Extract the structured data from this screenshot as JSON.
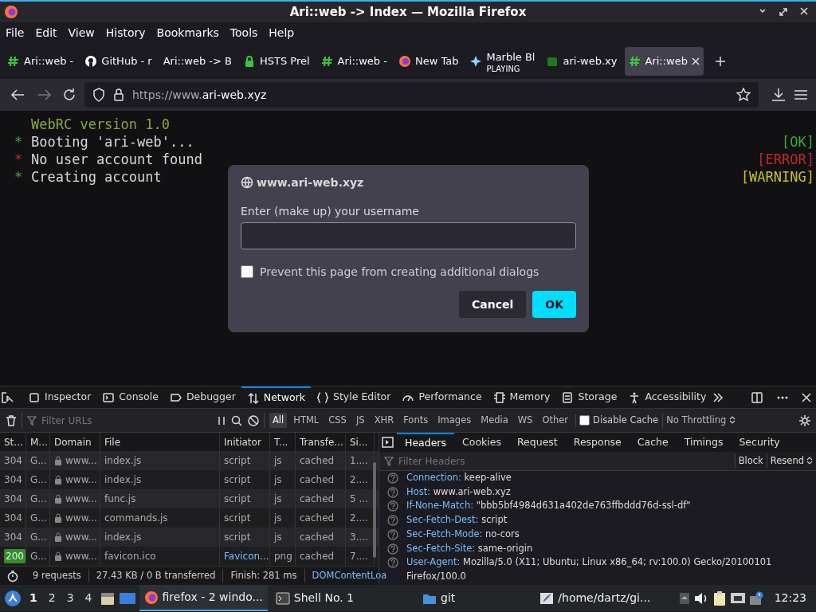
{
  "window": {
    "title": "Ari::web -> Index — Mozilla Firefox"
  },
  "menu": [
    "File",
    "Edit",
    "View",
    "History",
    "Bookmarks",
    "Tools",
    "Help"
  ],
  "tabs": [
    {
      "label": "Ari::web -",
      "kind": "hash",
      "selected": false
    },
    {
      "label": "GitHub - r",
      "kind": "github",
      "selected": false
    },
    {
      "label": "Ari::web -> B",
      "kind": "plain",
      "selected": false
    },
    {
      "label": "HSTS Prel",
      "kind": "lock",
      "selected": false
    },
    {
      "label": "Ari::web -",
      "kind": "hash",
      "selected": false
    },
    {
      "label": "New Tab",
      "kind": "firefox",
      "selected": false
    },
    {
      "label": "Marble Bl",
      "sub": "PLAYING",
      "kind": "marble",
      "selected": false
    },
    {
      "label": "ari-web.xy",
      "kind": "square",
      "selected": false
    },
    {
      "label": "Ari::web",
      "kind": "hash",
      "selected": true
    }
  ],
  "address": {
    "prefix": "https://www.",
    "host": "ari-web.xyz"
  },
  "terminal": [
    {
      "text": "WebRC version 1.0",
      "kind": "heading"
    },
    {
      "bullet": "*",
      "text": "Booting 'ari-web'...",
      "status": "[OK]",
      "kind": "ok"
    },
    {
      "bullet": "*",
      "text": "No user account found",
      "status": "[ERROR]",
      "kind": "error"
    },
    {
      "bullet": "*",
      "text": "Creating account",
      "status": "[WARNING]",
      "kind": "warning"
    }
  ],
  "dialog": {
    "host": "www.ari-web.xyz",
    "prompt": "Enter (make up) your username",
    "checkbox": {
      "label": "Prevent this page from creating additional dialogs",
      "checked": false
    },
    "buttons": [
      {
        "label": "Cancel",
        "kind": "secondary"
      },
      {
        "label": "OK",
        "kind": "primary"
      }
    ]
  },
  "devtools": {
    "tabs": [
      {
        "label": "Inspector",
        "selected": false
      },
      {
        "label": "Console",
        "selected": false
      },
      {
        "label": "Debugger",
        "selected": false
      },
      {
        "label": "Network",
        "selected": true
      },
      {
        "label": "Style Editor",
        "selected": false
      },
      {
        "label": "Performance",
        "selected": false
      },
      {
        "label": "Memory",
        "selected": false
      },
      {
        "label": "Storage",
        "selected": false
      },
      {
        "label": "Accessibility",
        "selected": false
      }
    ],
    "filter": {
      "placeholder": "Filter URLs"
    },
    "types": [
      {
        "label": "All",
        "selected": true
      },
      {
        "label": "HTML",
        "selected": false
      },
      {
        "label": "CSS",
        "selected": false
      },
      {
        "label": "JS",
        "selected": false
      },
      {
        "label": "XHR",
        "selected": false
      },
      {
        "label": "Fonts",
        "selected": false
      },
      {
        "label": "Images",
        "selected": false
      },
      {
        "label": "Media",
        "selected": false
      },
      {
        "label": "WS",
        "selected": false
      },
      {
        "label": "Other",
        "selected": false
      }
    ],
    "disable_cache": {
      "label": "Disable Cache",
      "checked": false
    },
    "throttling": "No Throttling",
    "table": {
      "columns": [
        "St...",
        "M...",
        "Domain",
        "File",
        "Initiator",
        "T...",
        "Transfe...",
        "Si..."
      ],
      "rows": [
        {
          "cells": [
            "304",
            "G...",
            "www...",
            "index.js",
            "script",
            "js",
            "cached",
            "1...."
          ],
          "success": false,
          "initiator_link": false
        },
        {
          "cells": [
            "304",
            "G...",
            "www...",
            "index.js",
            "script",
            "js",
            "cached",
            "2...."
          ],
          "success": false,
          "initiator_link": false
        },
        {
          "cells": [
            "304",
            "G...",
            "www...",
            "func.js",
            "script",
            "js",
            "cached",
            "5 ..."
          ],
          "success": false,
          "initiator_link": false
        },
        {
          "cells": [
            "304",
            "G...",
            "www...",
            "commands.js",
            "script",
            "js",
            "cached",
            "2...."
          ],
          "success": false,
          "initiator_link": false
        },
        {
          "cells": [
            "304",
            "G...",
            "www...",
            "index.js",
            "script",
            "js",
            "cached",
            "3...."
          ],
          "success": false,
          "initiator_link": false
        },
        {
          "cells": [
            "200",
            "G...",
            "www...",
            "favicon.ico",
            "Favicon...",
            "png",
            "cached",
            "7...."
          ],
          "success": true,
          "initiator_link": true
        }
      ]
    },
    "summary": [
      "9 requests",
      "27.43 KB / 0 B transferred",
      "Finish: 281 ms",
      "DOMContentLoa"
    ],
    "detail_tabs": [
      {
        "label": "Headers",
        "selected": true
      },
      {
        "label": "Cookies",
        "selected": false
      },
      {
        "label": "Request",
        "selected": false
      },
      {
        "label": "Response",
        "selected": false
      },
      {
        "label": "Cache",
        "selected": false
      },
      {
        "label": "Timings",
        "selected": false
      },
      {
        "label": "Security",
        "selected": false
      }
    ],
    "header_filter": {
      "placeholder": "Filter Headers"
    },
    "header_actions": [
      "Block",
      "Resend"
    ],
    "headers": [
      {
        "name": "Connection:",
        "value": "keep-alive"
      },
      {
        "name": "Host:",
        "value": "www.ari-web.xyz"
      },
      {
        "name": "If-None-Match:",
        "value": "\"bbb5bf4984d631a402de763ffbddd76d-ssl-df\""
      },
      {
        "name": "Sec-Fetch-Dest:",
        "value": "script"
      },
      {
        "name": "Sec-Fetch-Mode:",
        "value": "no-cors"
      },
      {
        "name": "Sec-Fetch-Site:",
        "value": "same-origin"
      },
      {
        "name": "User-Agent:",
        "value": "Mozilla/5.0 (X11; Ubuntu; Linux x86_64; rv:100.0) Gecko/20100101 Firefox/100.0"
      }
    ]
  },
  "taskbar": {
    "workspaces": [
      {
        "label": "1",
        "selected": true
      },
      {
        "label": "2",
        "selected": false
      },
      {
        "label": "3",
        "selected": false
      },
      {
        "label": "4",
        "selected": false
      }
    ],
    "tasks": [
      {
        "label": "firefox - 2 windo...",
        "kind": "firefox",
        "selected": true
      },
      {
        "label": "Shell No. 1",
        "kind": "terminal",
        "selected": false
      },
      {
        "label": "git",
        "kind": "folder",
        "selected": false
      },
      {
        "label": "/home/dartz/gi...",
        "kind": "editor",
        "selected": false
      }
    ],
    "clock": "12:23"
  }
}
